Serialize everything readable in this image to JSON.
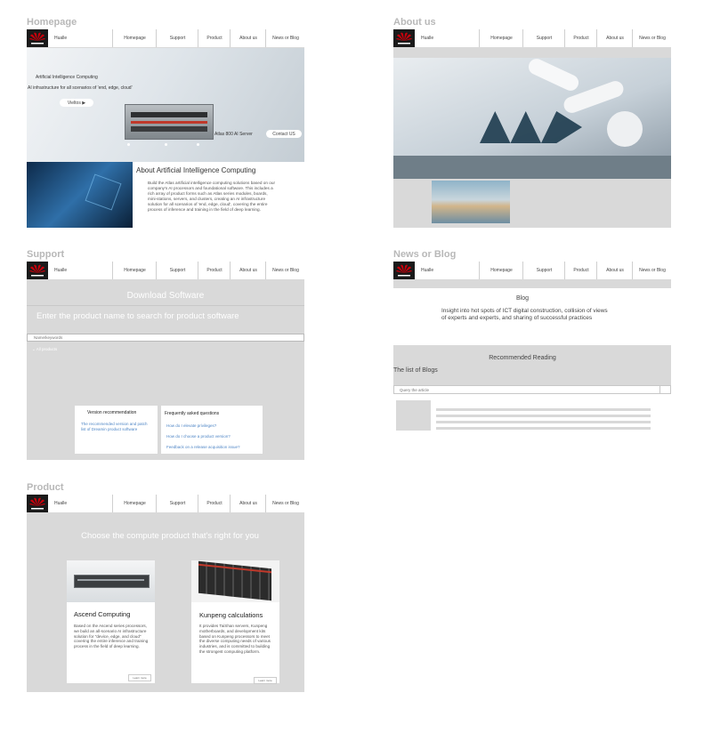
{
  "nav": {
    "brand": "Hualle",
    "items": [
      "Homepage",
      "Support",
      "Product",
      "About us",
      "News or Blog"
    ]
  },
  "boards": {
    "homepage": {
      "title": "Homepage",
      "hero_title": "Artificial Intelligence Computing",
      "hero_subtitle": "AI infrastructure for all scenarios of 'end, edge, cloud'",
      "hero_button": "Vieltos ▶",
      "server_caption": "Atlas 800 AI Server",
      "contact_button": "Contact US",
      "about_heading": "About Artificial Intelligence Computing",
      "about_text": "Build the Atlas artificial intelligence computing solutions based on our company's AI processors and foundational software. This includes a rich array of product forms such as Atlas series modules, boards, mini-stations, servers, and clusters, creating an AI infrastructure solution for all scenarios of 'end, edge, cloud', covering the entire process of inference and training in the field of deep learning."
    },
    "about": {
      "title": "About us"
    },
    "support": {
      "title": "Support",
      "heading": "Download Software",
      "subheading": "Enter the product name to search for product software",
      "search_placeholder": "Name/keywords",
      "filter_label": "All products",
      "version_title": "Version recommendation",
      "version_link": "The recommended version and patch list of Dreamin product software",
      "faq_title": "Frequently asked questions",
      "faq_items": [
        "How do I elevate privileges?",
        "How do I choose a product version?",
        "Feedback on a release acquisition issue?"
      ]
    },
    "news": {
      "title": "News or Blog",
      "blog_heading": "Blog",
      "blog_intro": "Insight into hot spots of ICT digital construction, collision of views of experts and experts, and sharing of successful practices",
      "recommended": "Recommended Reading",
      "list_title": "The list of Blogs",
      "search_placeholder": "Query the article"
    },
    "product": {
      "title": "Product",
      "heading": "Choose the compute product that's right for you",
      "cards": [
        {
          "title": "Ascend Computing",
          "text": "Based on the Ascend series processors, we build an all-scenario AI infrastructure solution for \"device, edge, and cloud\" covering the entire inference and training process in the field of deep learning.",
          "button": "Learn more"
        },
        {
          "title": "Kunpeng calculations",
          "text": "It provides TaiShan servers, Kunpeng motherboards, and development kits based on Kunpeng processors to meet the diverse computing needs of various industries, and is committed to building the strongest computing platform.",
          "button": "Learn more"
        }
      ]
    }
  },
  "colors": {
    "logo_red": "#c7000b",
    "link_blue": "#4f86c6",
    "frame_gray": "#d9d9d9",
    "board_title_gray": "#b8b8b8"
  }
}
